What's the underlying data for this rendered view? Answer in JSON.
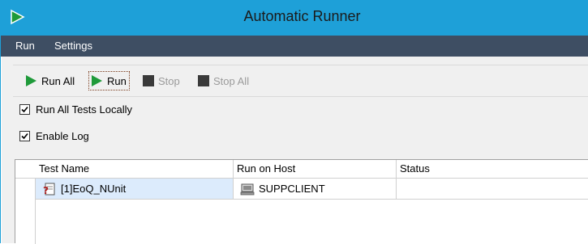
{
  "window": {
    "title": "Automatic Runner"
  },
  "menu": {
    "items": [
      "Run",
      "Settings"
    ]
  },
  "toolbar": {
    "run_all": "Run All",
    "run": "Run",
    "stop": "Stop",
    "stop_all": "Stop All"
  },
  "options": {
    "run_all_locally": {
      "label": "Run All Tests Locally",
      "checked": true
    },
    "enable_log": {
      "label": "Enable Log",
      "checked": true
    }
  },
  "grid": {
    "columns": [
      "Test Name",
      "Run on Host",
      "Status"
    ],
    "rows": [
      {
        "test_name": "[1]EoQ_NUnit",
        "host": "SUPPCLIENT",
        "status": ""
      }
    ]
  },
  "colors": {
    "titlebar": "#1ea0d8",
    "menubar": "#3e4e63",
    "run_green": "#1f9a3a",
    "selection": "#dcebfc"
  },
  "icons": {
    "app": "play-icon",
    "run_all": "play-icon",
    "run": "play-icon",
    "stop": "stop-icon",
    "stop_all": "stop-icon",
    "test": "test-file-icon",
    "host": "computer-icon"
  }
}
